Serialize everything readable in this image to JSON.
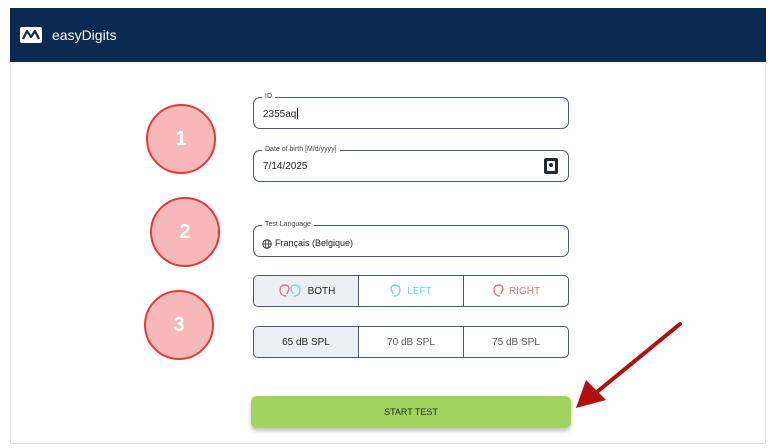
{
  "header": {
    "app_title": "easyDigits",
    "background": "#0b2a52",
    "logo_icon": "easydigits-logo-icon"
  },
  "form": {
    "id_field": {
      "label": "ID",
      "value": "2355aq"
    },
    "dob_field": {
      "label": "Date of birth [M/d/yyyy]",
      "value": "7/14/2025",
      "icon": "calendar-icon"
    },
    "language_field": {
      "label": "Test Language",
      "value": "Français (Belgique)",
      "icon": "globe-icon"
    },
    "ear_selector": {
      "options": [
        {
          "label": "BOTH",
          "icon": "both-ears-icon",
          "selected": true
        },
        {
          "label": "LEFT",
          "icon": "left-ear-icon",
          "selected": false
        },
        {
          "label": "RIGHT",
          "icon": "right-ear-icon",
          "selected": false
        }
      ]
    },
    "level_selector": {
      "options": [
        {
          "label": "65 dB SPL",
          "selected": true
        },
        {
          "label": "70 dB SPL",
          "selected": false
        },
        {
          "label": "75 dB SPL",
          "selected": false
        }
      ]
    },
    "start_button": {
      "label": "START TEST",
      "color": "#a3d35f"
    }
  },
  "annotations": {
    "badges": [
      "1",
      "2",
      "3"
    ],
    "badge_color": "#f6b8b8",
    "badge_border": "#e63a3a",
    "arrow_color": "#b01010",
    "arrow_icon": "arrow-pointer-icon"
  }
}
